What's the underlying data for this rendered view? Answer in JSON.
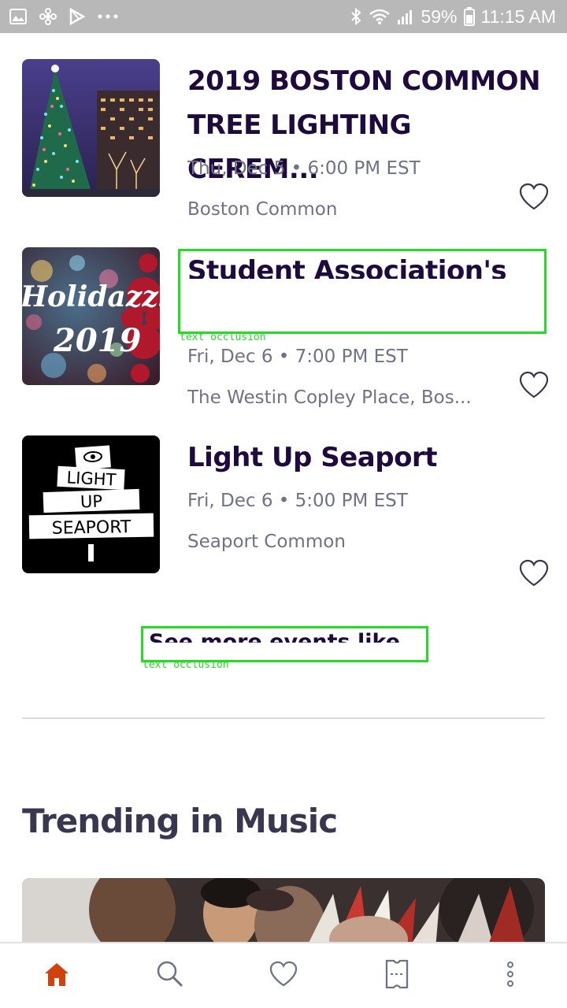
{
  "status_bar": {
    "battery": "59%",
    "time": "11:15 AM",
    "left_icons": [
      "gallery-icon",
      "pinwheel-icon",
      "play-store-icon",
      "more-dots-icon"
    ],
    "right_icons": [
      "bluetooth-icon",
      "wifi-icon",
      "signal-icon",
      "battery-icon"
    ]
  },
  "events": [
    {
      "title_line1": "2019 BOSTON COMMON",
      "title_line2": "TREE LIGHTING CEREM...",
      "date": "Thu, Dec 5 • 6:00 PM EST",
      "venue": "Boston Common",
      "image": "christmas-tree-photo"
    },
    {
      "title_line1": "Student Association's",
      "date": "Fri, Dec 6 • 7:00 PM EST",
      "venue": "The Westin Copley Place, Bos...",
      "image": "holidazzle-poster",
      "image_text_1": "Holidazzl",
      "image_text_2": "2019"
    },
    {
      "title_line1": "Light Up Seaport",
      "date": "Fri, Dec 6 • 5:00 PM EST",
      "venue": "Seaport Common",
      "image": "light-up-seaport-logo",
      "image_text_1": "LIGHT",
      "image_text_2": "UP",
      "image_text_3": "SEAPORT"
    }
  ],
  "occlusion_label": "text occlusion",
  "see_more": "See more events like this",
  "trending": {
    "title": "Trending in Music"
  },
  "nav": {
    "items": [
      "home-icon",
      "search-icon",
      "heart-icon",
      "tickets-icon",
      "more-vertical-icon"
    ],
    "active_color": "#d1410c",
    "inactive_color": "#6f7287"
  },
  "colors": {
    "title": "#1e0a3c",
    "meta": "#6f7287",
    "occlusion": "#22dd22"
  }
}
